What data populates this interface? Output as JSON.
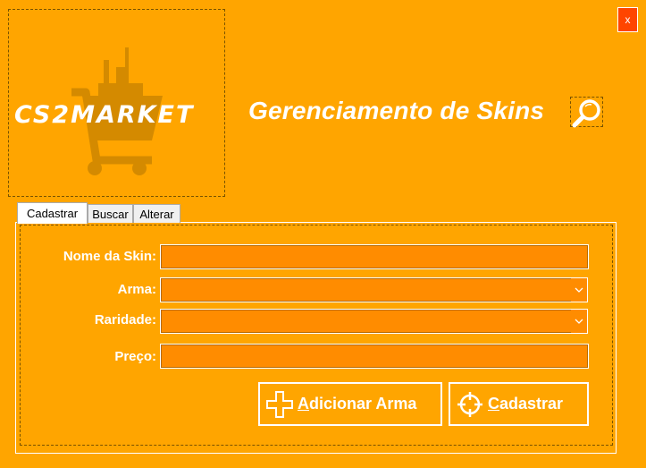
{
  "window": {
    "close_label": "X"
  },
  "logo": {
    "text": "CS2MARKET"
  },
  "header": {
    "title": "Gerenciamento de Skins",
    "search_icon": "magnifier-icon"
  },
  "tabs": [
    {
      "label": "Cadastrar",
      "selected": true
    },
    {
      "label": "Buscar",
      "selected": false
    },
    {
      "label": "Alterar",
      "selected": false
    }
  ],
  "form": {
    "skin_name_label": "Nome da Skin:",
    "skin_name_value": "",
    "weapon_label": "Arma:",
    "weapon_value": "",
    "rarity_label": "Raridade:",
    "rarity_value": "",
    "price_label": "Preço:",
    "price_value": ""
  },
  "buttons": {
    "add_weapon_label": "Adicionar Arma",
    "add_weapon_icon": "plus-icon",
    "register_label": "Cadastrar",
    "register_icon": "crosshair-icon"
  },
  "colors": {
    "background": "#FFA500",
    "field": "#FF8C00",
    "close": "#FF4500"
  }
}
